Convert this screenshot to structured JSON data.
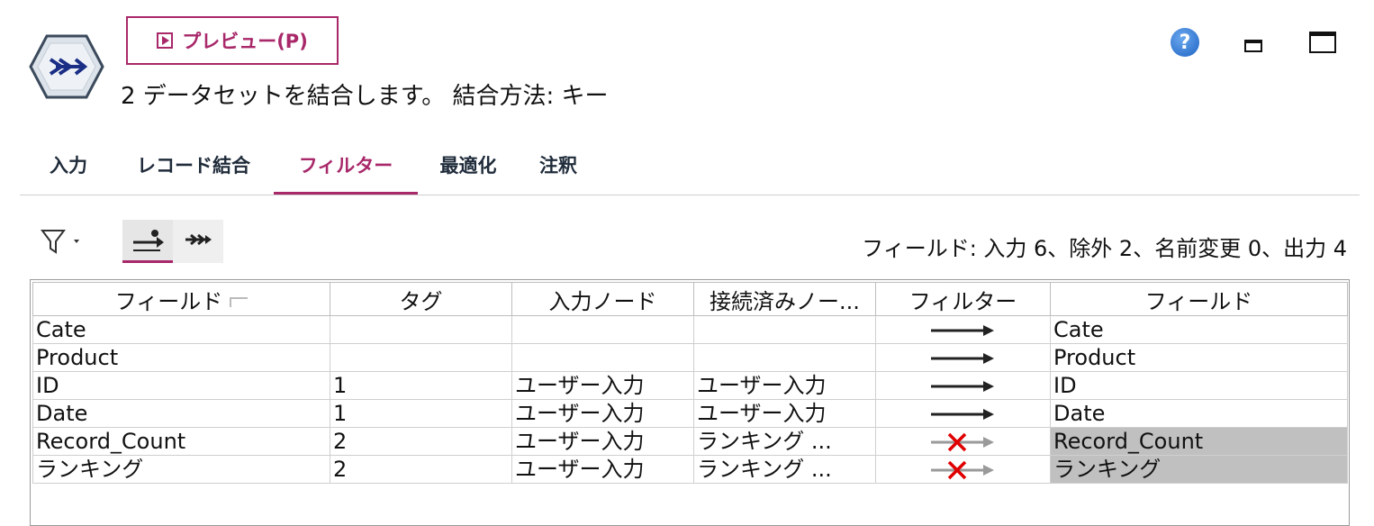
{
  "header": {
    "preview_label": "プレビュー(P)",
    "subtitle": "2 データセットを結合します。 結合方法: キー",
    "help_glyph": "?"
  },
  "tabs": [
    {
      "label": "入力",
      "active": false
    },
    {
      "label": "レコード結合",
      "active": false
    },
    {
      "label": "フィルター",
      "active": true
    },
    {
      "label": "最適化",
      "active": false
    },
    {
      "label": "注釈",
      "active": false
    }
  ],
  "toolbar": {
    "summary": "フィールド: 入力 6、除外 2、名前変更 0、出力 4"
  },
  "table": {
    "columns": [
      "フィールド",
      "タグ",
      "入力ノード",
      "接続済みノー...",
      "フィルター",
      "フィールド"
    ],
    "rows": [
      {
        "field": "Cate",
        "tag": "",
        "input_node": "",
        "connected_node": "",
        "filter": "pass",
        "output": "Cate"
      },
      {
        "field": "Product",
        "tag": "",
        "input_node": "",
        "connected_node": "",
        "filter": "pass",
        "output": "Product"
      },
      {
        "field": "ID",
        "tag": "1",
        "input_node": "ユーザー入力",
        "connected_node": "ユーザー入力",
        "filter": "pass",
        "output": "ID"
      },
      {
        "field": "Date",
        "tag": "1",
        "input_node": "ユーザー入力",
        "connected_node": "ユーザー入力",
        "filter": "pass",
        "output": "Date"
      },
      {
        "field": "Record_Count",
        "tag": "2",
        "input_node": "ユーザー入力",
        "connected_node": "ランキング ...",
        "filter": "excluded",
        "output": "Record_Count"
      },
      {
        "field": "ランキング",
        "tag": "2",
        "input_node": "ユーザー入力",
        "connected_node": "ランキング ...",
        "filter": "excluded",
        "output": "ランキング"
      }
    ]
  },
  "colors": {
    "accent": "#a8286a",
    "excluded_bg": "#c0c0c0",
    "exclude_x": "#e00000"
  }
}
